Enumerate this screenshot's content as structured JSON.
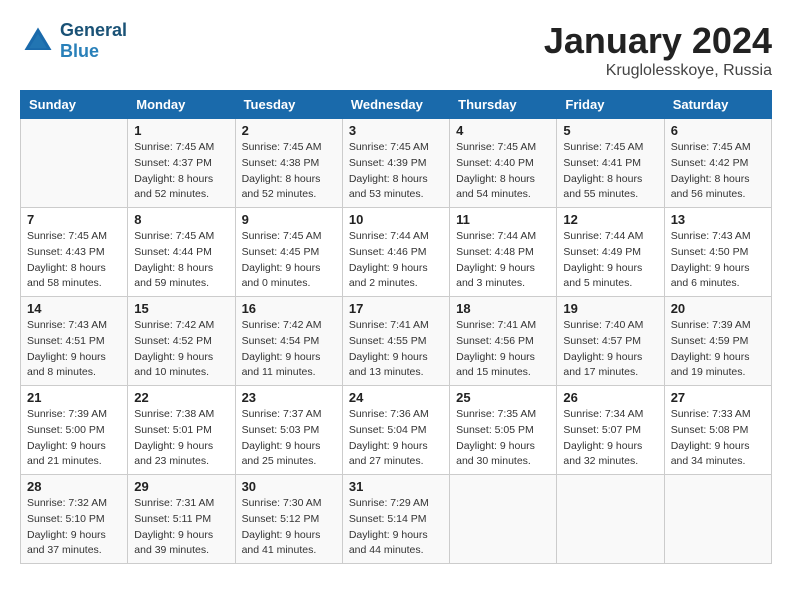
{
  "header": {
    "logo_line1": "General",
    "logo_line2": "Blue",
    "month_title": "January 2024",
    "location": "Kruglolesskoye, Russia"
  },
  "weekdays": [
    "Sunday",
    "Monday",
    "Tuesday",
    "Wednesday",
    "Thursday",
    "Friday",
    "Saturday"
  ],
  "weeks": [
    [
      {
        "day": "",
        "sunrise": "",
        "sunset": "",
        "daylight": "",
        "empty": true
      },
      {
        "day": "1",
        "sunrise": "Sunrise: 7:45 AM",
        "sunset": "Sunset: 4:37 PM",
        "daylight": "Daylight: 8 hours and 52 minutes."
      },
      {
        "day": "2",
        "sunrise": "Sunrise: 7:45 AM",
        "sunset": "Sunset: 4:38 PM",
        "daylight": "Daylight: 8 hours and 52 minutes."
      },
      {
        "day": "3",
        "sunrise": "Sunrise: 7:45 AM",
        "sunset": "Sunset: 4:39 PM",
        "daylight": "Daylight: 8 hours and 53 minutes."
      },
      {
        "day": "4",
        "sunrise": "Sunrise: 7:45 AM",
        "sunset": "Sunset: 4:40 PM",
        "daylight": "Daylight: 8 hours and 54 minutes."
      },
      {
        "day": "5",
        "sunrise": "Sunrise: 7:45 AM",
        "sunset": "Sunset: 4:41 PM",
        "daylight": "Daylight: 8 hours and 55 minutes."
      },
      {
        "day": "6",
        "sunrise": "Sunrise: 7:45 AM",
        "sunset": "Sunset: 4:42 PM",
        "daylight": "Daylight: 8 hours and 56 minutes."
      }
    ],
    [
      {
        "day": "7",
        "sunrise": "Sunrise: 7:45 AM",
        "sunset": "Sunset: 4:43 PM",
        "daylight": "Daylight: 8 hours and 58 minutes."
      },
      {
        "day": "8",
        "sunrise": "Sunrise: 7:45 AM",
        "sunset": "Sunset: 4:44 PM",
        "daylight": "Daylight: 8 hours and 59 minutes."
      },
      {
        "day": "9",
        "sunrise": "Sunrise: 7:45 AM",
        "sunset": "Sunset: 4:45 PM",
        "daylight": "Daylight: 9 hours and 0 minutes."
      },
      {
        "day": "10",
        "sunrise": "Sunrise: 7:44 AM",
        "sunset": "Sunset: 4:46 PM",
        "daylight": "Daylight: 9 hours and 2 minutes."
      },
      {
        "day": "11",
        "sunrise": "Sunrise: 7:44 AM",
        "sunset": "Sunset: 4:48 PM",
        "daylight": "Daylight: 9 hours and 3 minutes."
      },
      {
        "day": "12",
        "sunrise": "Sunrise: 7:44 AM",
        "sunset": "Sunset: 4:49 PM",
        "daylight": "Daylight: 9 hours and 5 minutes."
      },
      {
        "day": "13",
        "sunrise": "Sunrise: 7:43 AM",
        "sunset": "Sunset: 4:50 PM",
        "daylight": "Daylight: 9 hours and 6 minutes."
      }
    ],
    [
      {
        "day": "14",
        "sunrise": "Sunrise: 7:43 AM",
        "sunset": "Sunset: 4:51 PM",
        "daylight": "Daylight: 9 hours and 8 minutes."
      },
      {
        "day": "15",
        "sunrise": "Sunrise: 7:42 AM",
        "sunset": "Sunset: 4:52 PM",
        "daylight": "Daylight: 9 hours and 10 minutes."
      },
      {
        "day": "16",
        "sunrise": "Sunrise: 7:42 AM",
        "sunset": "Sunset: 4:54 PM",
        "daylight": "Daylight: 9 hours and 11 minutes."
      },
      {
        "day": "17",
        "sunrise": "Sunrise: 7:41 AM",
        "sunset": "Sunset: 4:55 PM",
        "daylight": "Daylight: 9 hours and 13 minutes."
      },
      {
        "day": "18",
        "sunrise": "Sunrise: 7:41 AM",
        "sunset": "Sunset: 4:56 PM",
        "daylight": "Daylight: 9 hours and 15 minutes."
      },
      {
        "day": "19",
        "sunrise": "Sunrise: 7:40 AM",
        "sunset": "Sunset: 4:57 PM",
        "daylight": "Daylight: 9 hours and 17 minutes."
      },
      {
        "day": "20",
        "sunrise": "Sunrise: 7:39 AM",
        "sunset": "Sunset: 4:59 PM",
        "daylight": "Daylight: 9 hours and 19 minutes."
      }
    ],
    [
      {
        "day": "21",
        "sunrise": "Sunrise: 7:39 AM",
        "sunset": "Sunset: 5:00 PM",
        "daylight": "Daylight: 9 hours and 21 minutes."
      },
      {
        "day": "22",
        "sunrise": "Sunrise: 7:38 AM",
        "sunset": "Sunset: 5:01 PM",
        "daylight": "Daylight: 9 hours and 23 minutes."
      },
      {
        "day": "23",
        "sunrise": "Sunrise: 7:37 AM",
        "sunset": "Sunset: 5:03 PM",
        "daylight": "Daylight: 9 hours and 25 minutes."
      },
      {
        "day": "24",
        "sunrise": "Sunrise: 7:36 AM",
        "sunset": "Sunset: 5:04 PM",
        "daylight": "Daylight: 9 hours and 27 minutes."
      },
      {
        "day": "25",
        "sunrise": "Sunrise: 7:35 AM",
        "sunset": "Sunset: 5:05 PM",
        "daylight": "Daylight: 9 hours and 30 minutes."
      },
      {
        "day": "26",
        "sunrise": "Sunrise: 7:34 AM",
        "sunset": "Sunset: 5:07 PM",
        "daylight": "Daylight: 9 hours and 32 minutes."
      },
      {
        "day": "27",
        "sunrise": "Sunrise: 7:33 AM",
        "sunset": "Sunset: 5:08 PM",
        "daylight": "Daylight: 9 hours and 34 minutes."
      }
    ],
    [
      {
        "day": "28",
        "sunrise": "Sunrise: 7:32 AM",
        "sunset": "Sunset: 5:10 PM",
        "daylight": "Daylight: 9 hours and 37 minutes."
      },
      {
        "day": "29",
        "sunrise": "Sunrise: 7:31 AM",
        "sunset": "Sunset: 5:11 PM",
        "daylight": "Daylight: 9 hours and 39 minutes."
      },
      {
        "day": "30",
        "sunrise": "Sunrise: 7:30 AM",
        "sunset": "Sunset: 5:12 PM",
        "daylight": "Daylight: 9 hours and 41 minutes."
      },
      {
        "day": "31",
        "sunrise": "Sunrise: 7:29 AM",
        "sunset": "Sunset: 5:14 PM",
        "daylight": "Daylight: 9 hours and 44 minutes."
      },
      {
        "day": "",
        "sunrise": "",
        "sunset": "",
        "daylight": "",
        "empty": true
      },
      {
        "day": "",
        "sunrise": "",
        "sunset": "",
        "daylight": "",
        "empty": true
      },
      {
        "day": "",
        "sunrise": "",
        "sunset": "",
        "daylight": "",
        "empty": true
      }
    ]
  ]
}
